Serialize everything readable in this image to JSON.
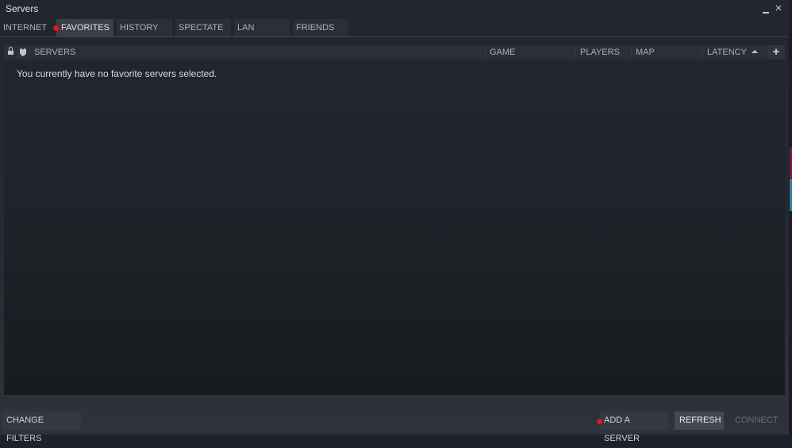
{
  "window": {
    "title": "Servers",
    "minimize_label": "minimize",
    "close_label": "×"
  },
  "tabs": [
    {
      "label": "INTERNET",
      "active": false
    },
    {
      "label": "FAVORITES",
      "active": true
    },
    {
      "label": "HISTORY",
      "active": false
    },
    {
      "label": "SPECTATE",
      "active": false
    },
    {
      "label": "LAN",
      "active": false
    },
    {
      "label": "FRIENDS",
      "active": false
    }
  ],
  "columns": {
    "lock_icon": "lock-icon",
    "secure_icon": "shield-icon",
    "servers": "SERVERS",
    "game": "GAME",
    "players": "PLAYERS",
    "map": "MAP",
    "latency": "LATENCY",
    "latency_sort": "ascending",
    "add_column": "+"
  },
  "list": {
    "empty_message": "You currently have no favorite servers selected."
  },
  "buttons": {
    "change_filters": "CHANGE FILTERS",
    "add_server": "ADD A SERVER",
    "refresh": "REFRESH",
    "connect": "CONNECT"
  },
  "colors": {
    "notification_dot": "#e8141b",
    "background": "#22262e",
    "accent_text": "#c6d4df"
  }
}
